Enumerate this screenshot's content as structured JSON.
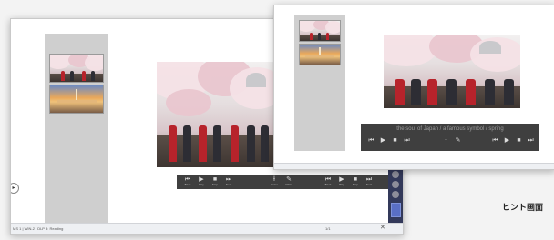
{
  "front_window": {
    "sentence": "the soul of Japan / a famous symbol / spring"
  },
  "back_window": {
    "taskbar_left": "MS 1 | WIN-2 | DLP 3: Reading",
    "page_indicator": "1/1"
  },
  "controls": {
    "left": [
      {
        "icon": "⏮",
        "label": "Back"
      },
      {
        "icon": "▶",
        "label": "Play"
      },
      {
        "icon": "■",
        "label": "Stop"
      },
      {
        "icon": "⏭",
        "label": "Next"
      }
    ],
    "middle": [
      {
        "icon": "Ɨ",
        "label": "Listen"
      },
      {
        "icon": "✎",
        "label": "Write"
      }
    ],
    "right": [
      {
        "icon": "⏮",
        "label": "Back"
      },
      {
        "icon": "▶",
        "label": "Play"
      },
      {
        "icon": "■",
        "label": "Stop"
      },
      {
        "icon": "⏭",
        "label": "Next"
      }
    ]
  },
  "caption": "ヒント画面",
  "icons": [
    "media-prev-icon",
    "media-play-icon",
    "media-stop-icon",
    "media-next-icon",
    "listen-icon",
    "pen-icon",
    "close-icon",
    "arrow-right-icon"
  ],
  "colors": {
    "control_bar": "#3f3f3f",
    "thumb_panel": "#cfcfcf",
    "side_panel": "#33395a",
    "accent": "#5a6fc4"
  }
}
